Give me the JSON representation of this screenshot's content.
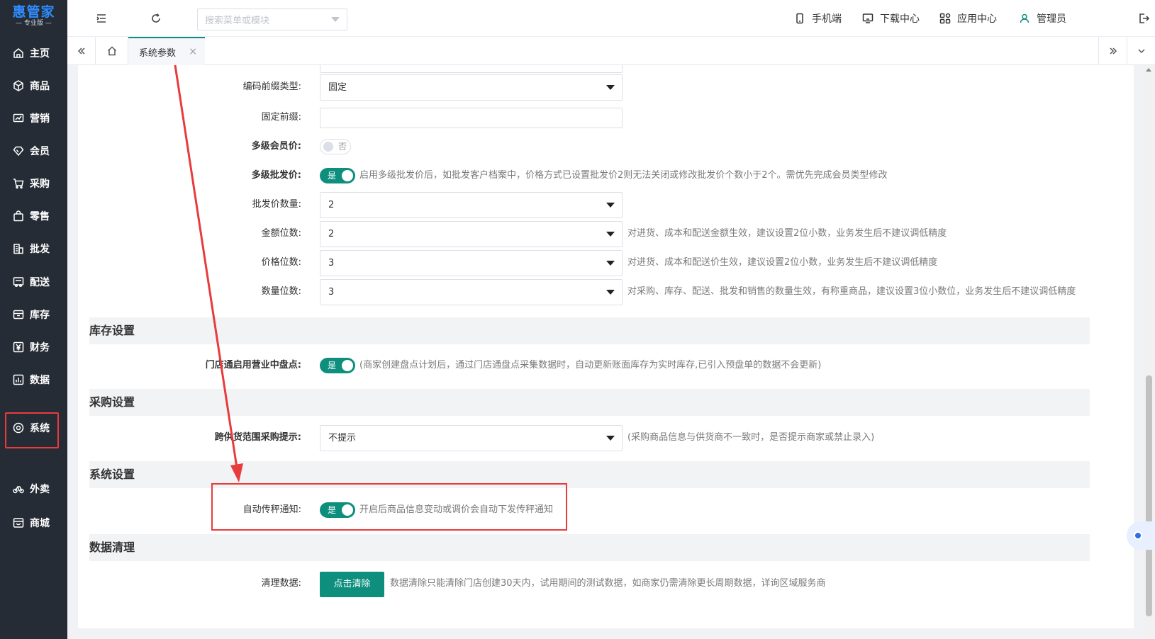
{
  "app": {
    "logo_main": "惠管家",
    "logo_sub": "— 专业版 —"
  },
  "sidebar": {
    "items": [
      {
        "label": "主页",
        "icon": "home-icon"
      },
      {
        "label": "商品",
        "icon": "cube-icon"
      },
      {
        "label": "营销",
        "icon": "chart-icon"
      },
      {
        "label": "会员",
        "icon": "diamond-icon"
      },
      {
        "label": "采购",
        "icon": "cart-icon"
      },
      {
        "label": "零售",
        "icon": "bag-icon"
      },
      {
        "label": "批发",
        "icon": "building-icon"
      },
      {
        "label": "配送",
        "icon": "truck-icon"
      },
      {
        "label": "库存",
        "icon": "box-icon"
      },
      {
        "label": "财务",
        "icon": "yen-icon"
      },
      {
        "label": "数据",
        "icon": "bar-icon"
      },
      {
        "label": "系统",
        "icon": "gear-icon"
      },
      {
        "label": "外卖",
        "icon": "bike-icon"
      },
      {
        "label": "商城",
        "icon": "shop-icon"
      }
    ]
  },
  "topbar": {
    "search_placeholder": "搜索菜单或模块",
    "mobile": "手机端",
    "download": "下载中心",
    "apps": "应用中心",
    "user": "管理员"
  },
  "tabs": {
    "active": "系统参数",
    "close": "×"
  },
  "form": {
    "code_prefix_type": {
      "label": "编码前缀类型:",
      "value": "固定"
    },
    "fixed_prefix": {
      "label": "固定前缀:",
      "value": ""
    },
    "multi_member_price": {
      "label": "多级会员价:",
      "toggle": "否"
    },
    "multi_wholesale_price": {
      "label": "多级批发价:",
      "toggle": "是",
      "hint": "启用多级批发价后，如批发客户档案中，价格方式已设置批发价2则无法关闭或修改批发价个数小于2个。需优先完成会员类型修改"
    },
    "wholesale_count": {
      "label": "批发价数量:",
      "value": "2"
    },
    "amount_digits": {
      "label": "金额位数:",
      "value": "2",
      "hint": "对进货、成本和配送金额生效，建议设置2位小数，业务发生后不建议调低精度"
    },
    "price_digits": {
      "label": "价格位数:",
      "value": "3",
      "hint": "对进货、成本和配送价生效，建议设置2位小数，业务发生后不建议调低精度"
    },
    "qty_digits": {
      "label": "数量位数:",
      "value": "3",
      "hint": "对采购、库存、配送、批发和销售的数量生效，有称重商品，建议设置3位小数位，业务发生后不建议调低精度"
    }
  },
  "sections": {
    "inventory": "库存设置",
    "purchase": "采购设置",
    "system": "系统设置",
    "cleanup": "数据清理"
  },
  "inventory": {
    "store_count": {
      "label": "门店通启用营业中盘点:",
      "toggle": "是",
      "hint": "(商家创建盘点计划后，通过门店通盘点采集数据时，自动更新账面库存为实时库存,已引入预盘单的数据不会更新)"
    }
  },
  "purchase": {
    "cross_supplier": {
      "label": "跨供货范围采购提示:",
      "value": "不提示",
      "hint": "(采购商品信息与供货商不一致时，是否提示商家或禁止录入)"
    }
  },
  "system": {
    "auto_scale": {
      "label": "自动传秤通知:",
      "toggle": "是",
      "hint": "开启后商品信息变动或调价会自动下发传秤通知"
    }
  },
  "cleanup": {
    "clear_data": {
      "label": "清理数据:",
      "button": "点击清除",
      "hint": "数据清除只能清除门店创建30天内，试用期间的测试数据，如商家仍需清除更长周期数据，详询区域服务商"
    }
  },
  "colors": {
    "primary": "#0e8f7e",
    "sidebar": "#262c35",
    "annotation": "#e83b3b"
  }
}
